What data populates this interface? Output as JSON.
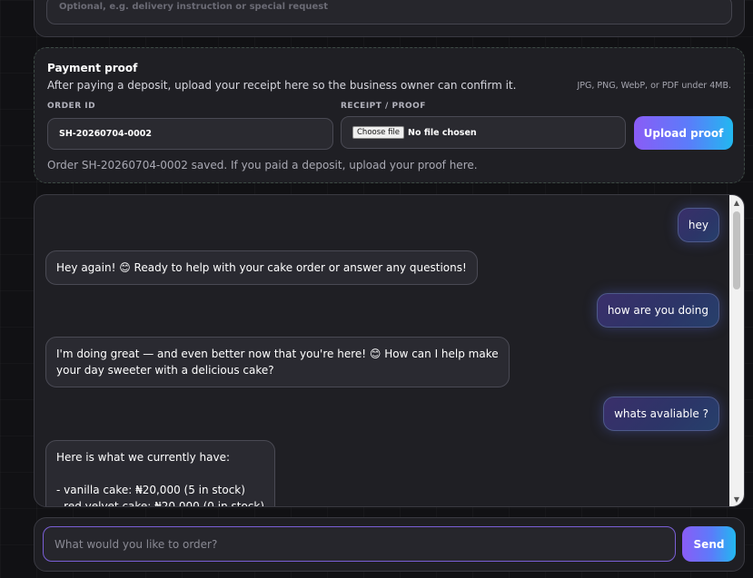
{
  "notes": {
    "placeholder": "Optional, e.g. delivery instruction or special request"
  },
  "payment": {
    "title": "Payment proof",
    "description": "After paying a deposit, upload your receipt here so the business owner can confirm it.",
    "formats": "JPG, PNG, WebP, or PDF under 4MB.",
    "order_id_label": "ORDER ID",
    "order_id_value": "SH-20260704-0002",
    "receipt_label": "RECEIPT / PROOF",
    "choose_file_label": "Choose file",
    "no_file_text": "No file chosen",
    "upload_label": "Upload proof",
    "status": "Order SH-20260704-0002 saved. If you paid a deposit, upload your proof here."
  },
  "chat": {
    "messages": [
      {
        "role": "user",
        "text": "hey"
      },
      {
        "role": "bot",
        "text": "Hey again! 😊 Ready to help with your cake order or answer any questions!"
      },
      {
        "role": "user",
        "text": "how are you doing"
      },
      {
        "role": "bot",
        "text": "I'm doing great — and even better now that you're here! 😊 How can I help make\nyour day sweeter with a delicious cake?"
      },
      {
        "role": "user",
        "text": "whats avaliable ?"
      },
      {
        "role": "bot",
        "text": "Here is what we currently have:\n\n- vanilla cake: ₦20,000 (5 in stock)\n- red velvet cake: ₦20,000 (0 in stock)"
      }
    ]
  },
  "composer": {
    "placeholder": "What would you like to order?",
    "send_label": "Send"
  }
}
